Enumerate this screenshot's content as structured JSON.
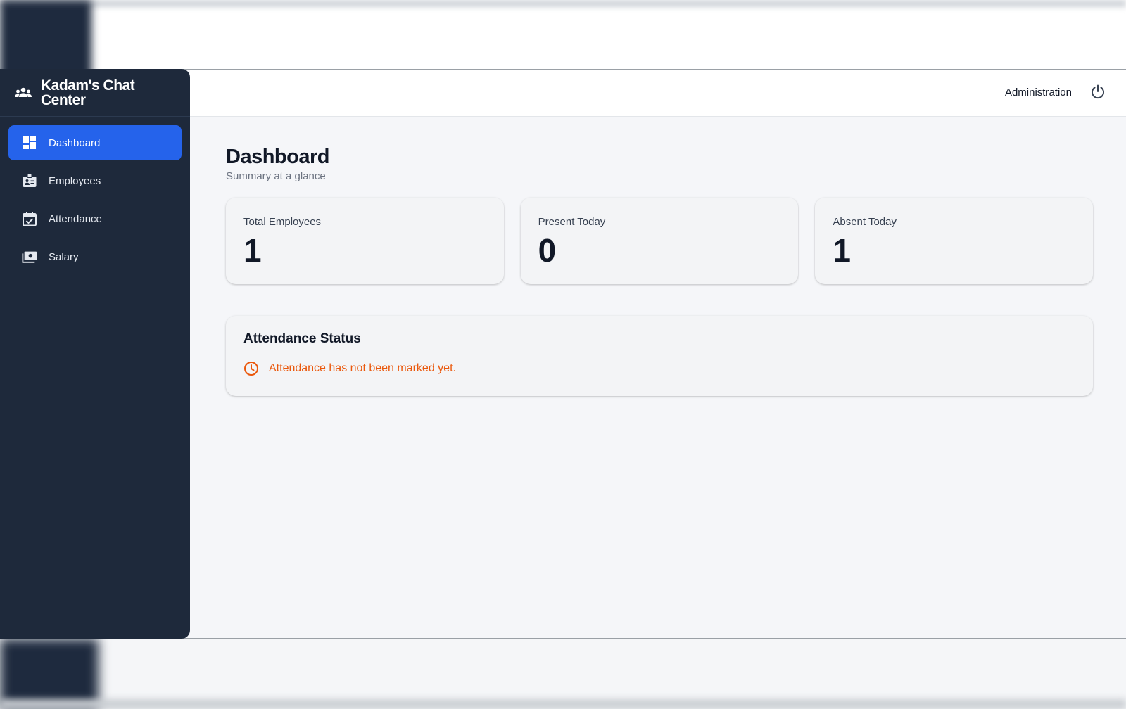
{
  "brand": {
    "name": "Kadam's Chat Center",
    "icon": "group-icon"
  },
  "sidebar": {
    "items": [
      {
        "label": "Dashboard",
        "icon": "dashboard-icon",
        "active": true
      },
      {
        "label": "Employees",
        "icon": "badge-icon",
        "active": false
      },
      {
        "label": "Attendance",
        "icon": "calendar-check-icon",
        "active": false
      },
      {
        "label": "Salary",
        "icon": "payments-icon",
        "active": false
      }
    ]
  },
  "topbar": {
    "admin_label": "Administration",
    "power_icon": "power-icon"
  },
  "page": {
    "title": "Dashboard",
    "subtitle": "Summary at a glance"
  },
  "stats": [
    {
      "label": "Total Employees",
      "value": "1"
    },
    {
      "label": "Present Today",
      "value": "0"
    },
    {
      "label": "Absent Today",
      "value": "1"
    }
  ],
  "attendance_status": {
    "title": "Attendance Status",
    "message": "Attendance has not been marked yet.",
    "icon": "clock-icon"
  },
  "colors": {
    "sidebar_bg": "#1e293b",
    "accent": "#2563eb",
    "warning": "#ea580c",
    "content_bg": "#f5f6f9"
  }
}
